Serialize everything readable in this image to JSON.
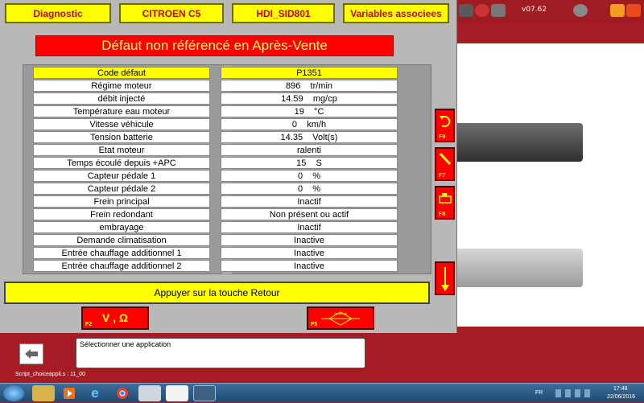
{
  "window": {
    "tabs": [
      "Diagnostic",
      "CITROEN C5",
      "HDI_SID801",
      "Variables associees"
    ],
    "banner": "Défaut non référencé en Après-Vente"
  },
  "params": {
    "header": {
      "label": "Code défaut",
      "value": "P1351"
    },
    "rows": [
      {
        "label": "Régime moteur",
        "value": "896    tr/min"
      },
      {
        "label": "débit injecté",
        "value": "14.59    mg/cp"
      },
      {
        "label": "Température eau moteur",
        "value": "19    °C"
      },
      {
        "label": "Vitesse véhicule",
        "value": "0    km/h"
      },
      {
        "label": "Tension batterie",
        "value": "14.35    Volt(s)"
      },
      {
        "label": "Etat moteur",
        "value": "ralenti"
      },
      {
        "label": "Temps écoulé depuis +APC",
        "value": "15    S"
      },
      {
        "label": "Capteur pédale 1",
        "value": "0    %"
      },
      {
        "label": "Capteur pédale 2",
        "value": "0    %"
      },
      {
        "label": "Frein principal",
        "value": "Inactif"
      },
      {
        "label": "Frein redondant",
        "value": "Non présent ou actif"
      },
      {
        "label": "embrayage",
        "value": "Inactif"
      },
      {
        "label": "Demande climatisation",
        "value": "Inactive"
      },
      {
        "label": "Entrée chauffage additionnel 1",
        "value": "Inactive"
      },
      {
        "label": "Entrée chauffage additionnel 2",
        "value": "Inactive"
      }
    ]
  },
  "side_keys": [
    {
      "key": "F9",
      "icon": "undo-arrow-icon"
    },
    {
      "key": "F7",
      "icon": "probe-icon"
    },
    {
      "key": "F8",
      "icon": "engine-icon"
    },
    {
      "key": "",
      "icon": "scroll-down-arrow-icon"
    }
  ],
  "retour_label": "Appuyer sur la touche Retour",
  "bottom_buttons": [
    {
      "key": "F2",
      "label": "V , Ω"
    },
    {
      "key": "F5",
      "icon": "signal-icon"
    }
  ],
  "host": {
    "version": "v07.62",
    "app_select_text": "Sélectionner une application",
    "script_label": "Script_choiceappli.s : 11_00"
  },
  "taskbar": {
    "lang": "FR",
    "time": "17:48",
    "date": "22/06/2016"
  },
  "colors": {
    "accent_yellow": "#ffff00",
    "accent_red": "#ff0000",
    "host_red": "#a51c24"
  }
}
